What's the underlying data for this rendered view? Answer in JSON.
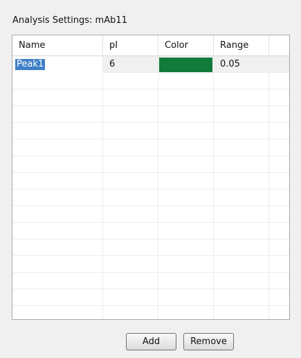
{
  "panel": {
    "title": "Analysis Settings: mAb11"
  },
  "table": {
    "columns": [
      "Name",
      "pI",
      "Color",
      "Range",
      ""
    ],
    "rows": [
      {
        "name": "Peak1",
        "pi": "6",
        "color": "#107b3a",
        "range": "0.05"
      }
    ],
    "empty_row_count": 15
  },
  "buttons": {
    "add_label": "Add",
    "remove_label": "Remove"
  }
}
